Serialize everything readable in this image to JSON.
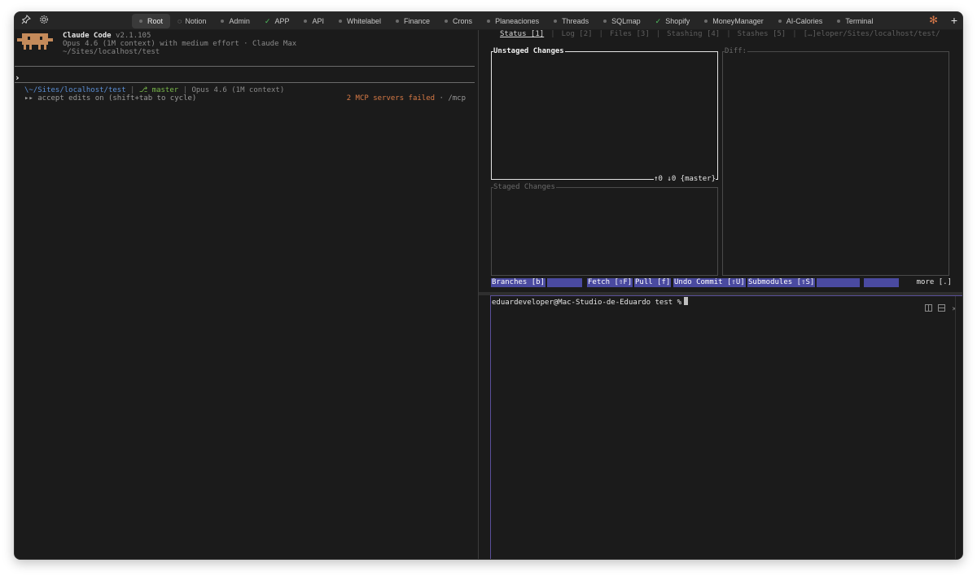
{
  "tabbar": {
    "tabs": [
      {
        "label": "Root",
        "active": true,
        "marker": "dot"
      },
      {
        "label": "Notion",
        "marker": "spinner"
      },
      {
        "label": "Admin",
        "marker": "dot"
      },
      {
        "label": "APP",
        "marker": "check"
      },
      {
        "label": "API",
        "marker": "dot"
      },
      {
        "label": "Whitelabel",
        "marker": "dot"
      },
      {
        "label": "Finance",
        "marker": "dot"
      },
      {
        "label": "Crons",
        "marker": "dot"
      },
      {
        "label": "Planeaciones",
        "marker": "dot"
      },
      {
        "label": "Threads",
        "marker": "dot"
      },
      {
        "label": "SQLmap",
        "marker": "dot"
      },
      {
        "label": "Shopify",
        "marker": "check"
      },
      {
        "label": "MoneyManager",
        "marker": "dot"
      },
      {
        "label": "AI-Calories",
        "marker": "dot"
      },
      {
        "label": "Terminal",
        "marker": "dot"
      }
    ],
    "icons": {
      "pin": "pin-icon",
      "settings": "gear-icon",
      "spark": "claude-spark-icon",
      "add": "plus-icon"
    }
  },
  "claude": {
    "title": "Claude Code",
    "version": "v2.1.105",
    "model_line": "Opus 4.6 (1M context) with medium effort · Claude Max",
    "cwd": "~/Sites/localhost/test",
    "prompt_symbol": "›",
    "status": {
      "path": "\\~/Sites/localhost/test",
      "sep1": "|",
      "branch": "⎇ master",
      "sep2": "|",
      "model": "Opus 4.6 (1M context)"
    },
    "hint": "▸▸ accept edits on (shift+tab to cycle)",
    "mcp_warning": "2 MCP servers failed",
    "mcp_suffix": " · /mcp"
  },
  "lazygit": {
    "tabs": [
      "Status [1]",
      "Log [2]",
      "Files [3]",
      "Stashing [4]",
      "Stashes [5]",
      "[…]eloper/Sites/localhost/test/"
    ],
    "unstaged_title": "Unstaged Changes",
    "unstaged_footer": "↑0 ↓0 {master}",
    "staged_title": "Staged Changes",
    "diff_title": "Diff:",
    "keybindings": [
      "Branches [b]",
      "Fetch [⇧F]",
      "Pull [f]",
      "Undo Commit [⇧U]",
      "Submodules [⇧S]"
    ],
    "more": "more [.]"
  },
  "terminal": {
    "prompt": "eduardeveloper@Mac-Studio-de-Eduardo test %",
    "controls": [
      "split-icon",
      "maximize-icon",
      "close-icon"
    ]
  },
  "colors": {
    "accent_purple": "#4a4aa0",
    "path_blue": "#5b8fd6",
    "branch_green": "#79b84a",
    "warning_orange": "#d77a46",
    "claude_mascot": "#c48a5a"
  }
}
